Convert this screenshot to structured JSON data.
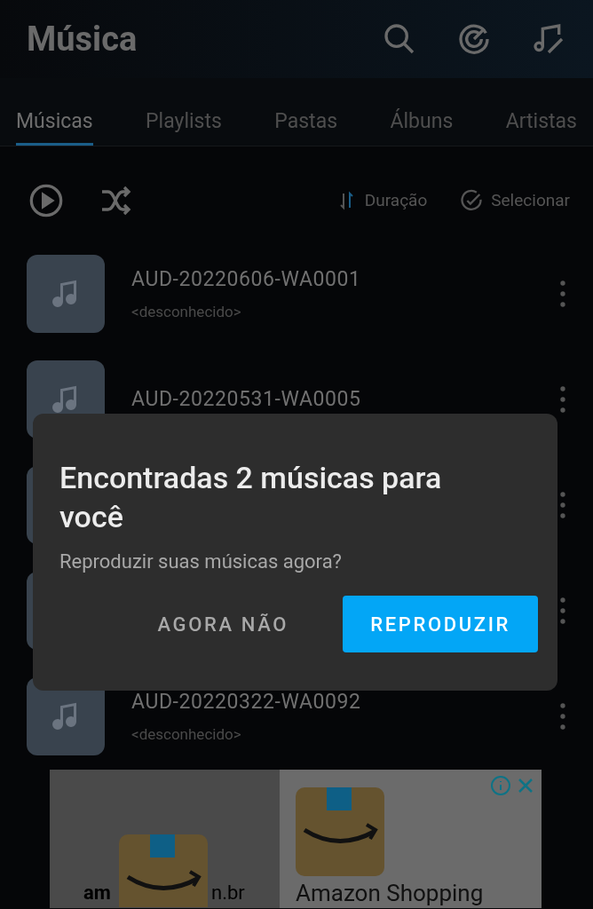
{
  "header": {
    "title": "Música"
  },
  "tabs": [
    {
      "label": "Músicas",
      "selected": true
    },
    {
      "label": "Playlists",
      "selected": false
    },
    {
      "label": "Pastas",
      "selected": false
    },
    {
      "label": "Álbuns",
      "selected": false
    },
    {
      "label": "Artistas",
      "selected": false
    }
  ],
  "toolbar": {
    "sort": "Duração",
    "select": "Selecionar"
  },
  "songs": [
    {
      "kind": "track",
      "title": "AUD-20220606-WA0001",
      "artist": "<desconhecido>"
    },
    {
      "kind": "track",
      "title": "AUD-20220531-WA0005"
    },
    {
      "kind": "covered"
    },
    {
      "kind": "covered"
    },
    {
      "kind": "track",
      "title": "AUD-20220322-WA0092",
      "artist": "<desconhecido>"
    }
  ],
  "dialog": {
    "title": "Encontradas 2 músicas para você",
    "message": "Reproduzir suas músicas agora?",
    "buttons": [
      {
        "label": "AGORA NÃO",
        "kind": "text"
      },
      {
        "label": "REPRODUZIR",
        "kind": "primary"
      }
    ]
  },
  "ad": {
    "left_texts": [
      "am",
      "n.br"
    ],
    "right_title": "Amazon Shopping"
  }
}
